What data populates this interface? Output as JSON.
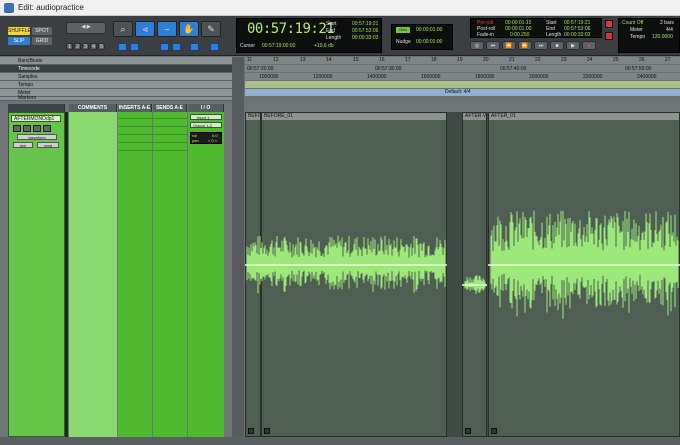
{
  "window": {
    "title": "Edit: audiopractice"
  },
  "modes": {
    "shuffle": "SHUFFLE",
    "spot": "SPOT",
    "slip": "SLIP",
    "grid": "GRID"
  },
  "zoom_presets": [
    "1",
    "2",
    "3",
    "4",
    "5"
  ],
  "main_counter": "00:57:19:21",
  "cursor": {
    "label": "Cursor",
    "value": "00:57:19:00:00",
    "level": "+19.6 db"
  },
  "selection": {
    "start_label": "Start",
    "start": "00:57:19:21",
    "end_label": "End",
    "end": "00:57:53:06",
    "length_label": "Length",
    "length": "00:00:33:03"
  },
  "grid_nudge": {
    "grid_label": "Grid",
    "grid_value": "00:00:01:00",
    "nudge_label": "Nudge",
    "nudge_value": "00:00:01:00"
  },
  "preroll": {
    "pre_label": "Pre-roll",
    "pre": "00:00:01:15",
    "post_label": "Post-roll",
    "post": "00:00:01:00",
    "fade_label": "Fade-in",
    "fade": "0:00.250"
  },
  "transport_counter": {
    "start_label": "Start",
    "start": "00:57:19:21",
    "end_label": "End",
    "end": "00:57:53:06",
    "length_label": "Length",
    "length": "00:00:33:03"
  },
  "count_off": {
    "label": "Count Off",
    "bars": "2 bars",
    "meter_label": "Meter",
    "meter": "4/4",
    "tempo_label": "Tempo",
    "tempo": "120.0000"
  },
  "rulers": {
    "rows": [
      "Bars|Beats",
      "Timecode",
      "Samples",
      "Tempo",
      "Meter",
      "Markers"
    ],
    "bars": [
      "11",
      "12",
      "13",
      "14",
      "15",
      "16",
      "17",
      "18",
      "19",
      "20",
      "21",
      "22",
      "23",
      "24",
      "25",
      "26",
      "27"
    ],
    "timecode": [
      "00:57:20:00",
      "00:57:30:00",
      "00:57:40:00",
      "00:57:50:00"
    ],
    "samples": [
      "1000000",
      "1200000",
      "1400000",
      "1600000",
      "1800000",
      "2000000",
      "2200000",
      "2400000"
    ],
    "meter_marker": "Default: 4/4"
  },
  "columns": {
    "comments": "COMMENTS",
    "inserts": "INSERTS A-E",
    "sends": "SENDS A-E",
    "io": "I / O"
  },
  "track": {
    "name": "AFTERMONOdp1",
    "mode": "waveform",
    "dyn": "dyn",
    "read": "read",
    "input": "Input 1",
    "output": "Output 1-2",
    "vol_label": "vol",
    "vol": "0.0",
    "pan_label": "pan",
    "pan": "> 0 <"
  },
  "clips": [
    {
      "name": "BEFO"
    },
    {
      "name": "BEFORE_01"
    },
    {
      "name": "AFTER VO"
    },
    {
      "name": "AFTER_01"
    }
  ],
  "colors": {
    "track_green": "#66c44a",
    "waveform": "#9ce87a",
    "counter_green": "#b8ef5e"
  }
}
